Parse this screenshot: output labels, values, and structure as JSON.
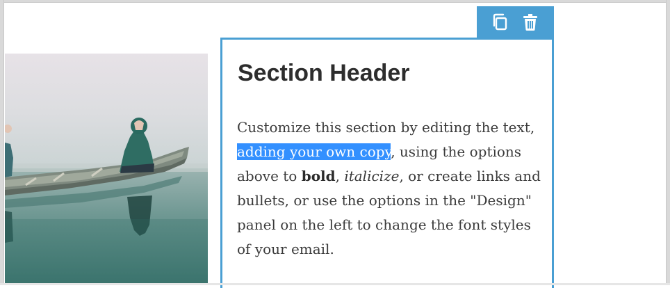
{
  "toolbar": {
    "duplicate_icon": "duplicate-icon",
    "delete_icon": "trash-icon",
    "accent_color": "#4a9fd3"
  },
  "section": {
    "title": "Section Header",
    "body": {
      "part1": "Customize this section by editing the text, ",
      "selected": "adding your own copy",
      "part2": ", using the options above to ",
      "bold_word": "bold",
      "part3": ", ",
      "italic_word": "italicize",
      "part4": ", or create links and bullets, or use the options in the \"Design\" panel on the left to change the font styles of your email."
    },
    "selection_color": "#3390ff"
  },
  "image": {
    "icon": "canoe-photo"
  }
}
